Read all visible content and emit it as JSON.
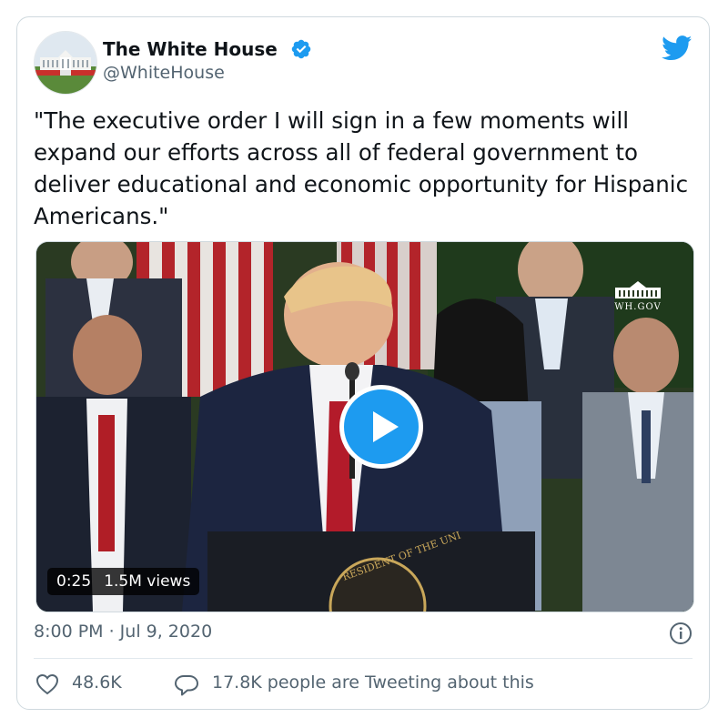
{
  "author": {
    "name": "The White House",
    "handle": "@WhiteHouse",
    "verified": true
  },
  "tweet": {
    "text": "\"The executive order I will sign in a few moments will expand our efforts across all of federal government to deliver educational and economic opportunity for Hispanic Americans.\"",
    "timestamp": "8:00 PM · Jul 9, 2020"
  },
  "video": {
    "duration": "0:25",
    "views": "1.5M views",
    "watermark": "WH.GOV",
    "podium_text": "RESIDENT OF THE UNI"
  },
  "engagement": {
    "likes": "48.6K",
    "tweeting": "17.8K people are Tweeting about this"
  },
  "colors": {
    "accent": "#1d9bf0",
    "text": "#0f1419",
    "secondary": "#536471",
    "border": "#cfd9de"
  },
  "icons": [
    "verified-badge-icon",
    "twitter-bird-icon",
    "play-icon",
    "info-icon",
    "heart-icon",
    "speech-bubble-icon"
  ]
}
